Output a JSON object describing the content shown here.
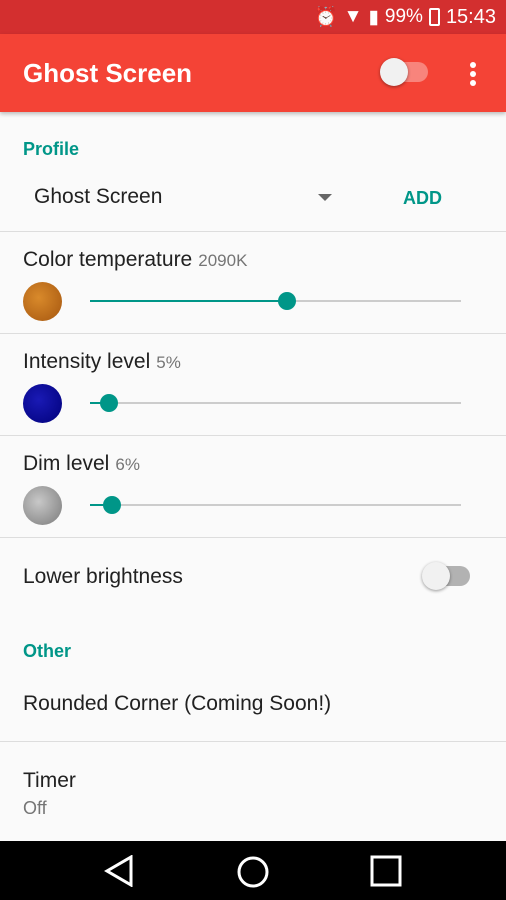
{
  "status_bar": {
    "battery": "99%",
    "time": "15:43",
    "icons": [
      "alarm-icon",
      "wifi-icon",
      "signal-icon",
      "battery-charging-icon"
    ]
  },
  "app_bar": {
    "title": "Ghost Screen",
    "master_switch_on": false,
    "menu_icon": "more-vert-icon"
  },
  "profile": {
    "header": "Profile",
    "selected": "Ghost Screen",
    "add_label": "ADD"
  },
  "color_temperature": {
    "label": "Color temperature",
    "value": "2090K",
    "slider_fraction": 0.53
  },
  "intensity": {
    "label": "Intensity level",
    "value": "5%",
    "slider_fraction": 0.05
  },
  "dim": {
    "label": "Dim level",
    "value": "6%",
    "slider_fraction": 0.06
  },
  "lower_brightness": {
    "label": "Lower brightness",
    "on": false
  },
  "other": {
    "header": "Other",
    "rounded_corner": "Rounded Corner (Coming Soon!)",
    "timer_label": "Timer",
    "timer_value": "Off"
  },
  "colors": {
    "primary": "#f44336",
    "status": "#d32f2f",
    "accent": "#009688"
  }
}
